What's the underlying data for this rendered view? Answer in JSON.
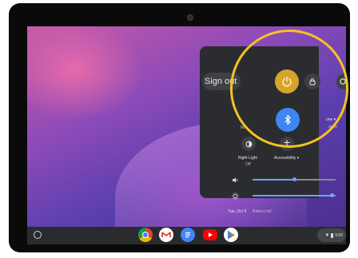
{
  "quick_settings": {
    "sign_out": "Sign out",
    "bluetooth_label": "Ma",
    "partial_right_label": "one ▾",
    "partial_right_sub": "apps",
    "night_light_label": "Night Light",
    "night_light_state": "Off",
    "accessibility_label": "Accessibility ▾",
    "volume_level": 0.5,
    "brightness_level": 0.95,
    "date_text": "Tue, Oct 9",
    "battery_text": "Battery full"
  },
  "status_tray": {
    "time": "9:00"
  },
  "colors": {
    "panel_bg": "#2b2c30",
    "power_accent": "#d8a32a",
    "bluetooth_accent": "#3f86f0",
    "highlight_ring": "#f3c322"
  },
  "shelf_apps": [
    "chrome-icon",
    "gmail-icon",
    "docs-icon",
    "youtube-icon",
    "play-store-icon"
  ]
}
